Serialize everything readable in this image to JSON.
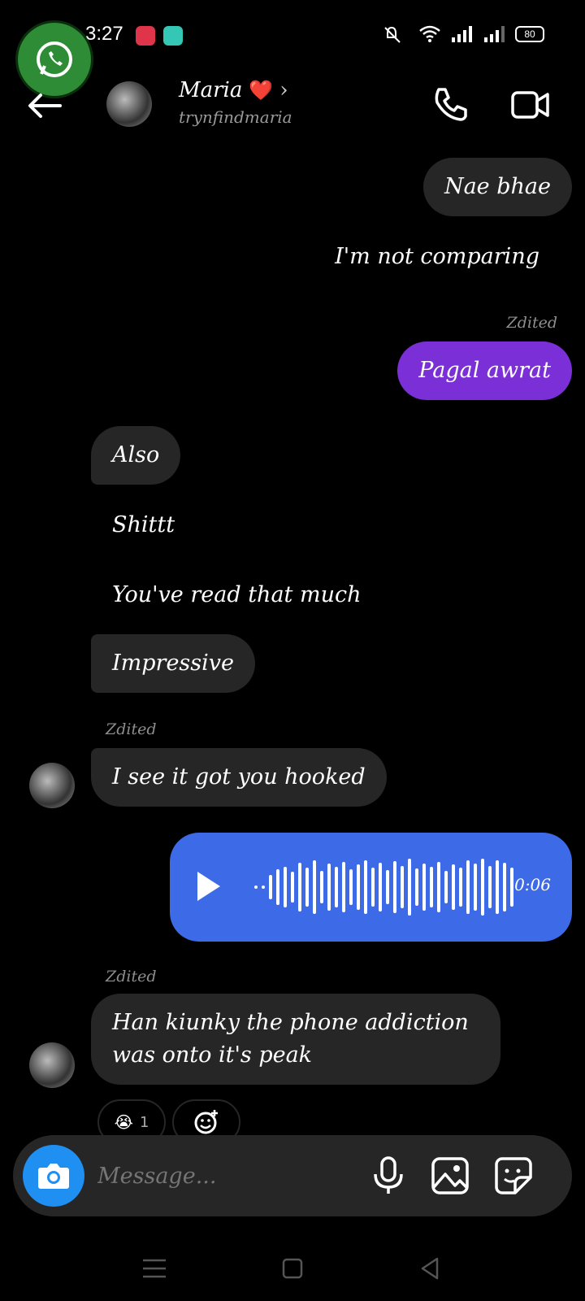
{
  "status_bar": {
    "time": "3:27",
    "battery": "80"
  },
  "header": {
    "name": "Maria",
    "heart": "❤️",
    "username": "trynfindmaria"
  },
  "messages": {
    "m1": "Nae bhae",
    "m2": "I'm not comparing",
    "m3_edited": "Zdited",
    "m3": "Pagal awrat",
    "m4": "Also",
    "m5": "Shittt",
    "m6": "You've read that much",
    "m7": "Impressive",
    "m8_edited": "Zdited",
    "m8": "I see it got you hooked",
    "voice_duration": "0:06",
    "m9_edited": "Zdited",
    "m9_line1": "Han kiunky the phone addiction",
    "m9_line2": "was onto it's peak"
  },
  "reactions": {
    "emoji": "😭",
    "count": "1"
  },
  "input": {
    "placeholder": "Message..."
  },
  "colors": {
    "purple_bubble": "#7b2fd6",
    "voice_bubble": "#3d6ae6",
    "camera": "#1f8ff2",
    "incoming": "#262626"
  },
  "icons": [
    "whatsapp-icon",
    "back-arrow-icon",
    "phone-icon",
    "video-icon",
    "play-icon",
    "camera-icon",
    "mic-icon",
    "image-icon",
    "sticker-icon",
    "add-reaction-icon"
  ]
}
